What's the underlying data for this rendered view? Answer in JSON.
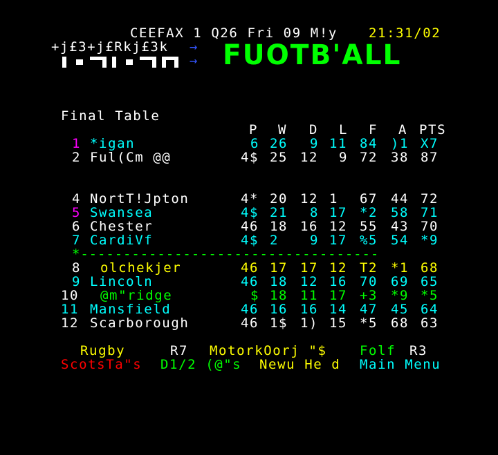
{
  "header": {
    "service": "CEEFAX 1 Q26 Fri 09 M!y",
    "clock": "21:31/02"
  },
  "mosaic_garble": "+j£3+j£Rkj£3k",
  "arrow1": "→",
  "arrow2": "→",
  "logo_text": "FUOTB'ALL",
  "table_title": "Final Table",
  "columns": [
    "P",
    "W",
    "D",
    "L",
    "F",
    "A",
    "PTS"
  ],
  "rows": [
    {
      "pos": "1",
      "team": "*igan",
      "p": "6",
      "w": "26",
      "d": "9",
      "l": "11",
      "f": "84",
      "a": ")1",
      "pts": "X7"
    },
    {
      "pos": "2",
      "team": "Ful(Cm @@",
      "p": "4$",
      "w": "25",
      "d": "12",
      "l": "9",
      "f": "72",
      "a": "38",
      "pts": "87"
    },
    {
      "pos": "4",
      "team": "NortT!Jpton",
      "p": "4*",
      "w": "20",
      "d": "12",
      "l": "1",
      "f": "67",
      "a": "44",
      "pts": "72"
    },
    {
      "pos": "5",
      "team": "Swansea",
      "p": "4$",
      "w": "21",
      "d": "8",
      "l": "17",
      "f": "*2",
      "a": "58",
      "pts": "71"
    },
    {
      "pos": "6",
      "team": "Chester",
      "p": "46",
      "w": "18",
      "d": "16",
      "l": "12",
      "f": "55",
      "a": "43",
      "pts": "70"
    },
    {
      "pos": "7",
      "team": "CardiVf",
      "p": "4$",
      "w": "2",
      "d": "9",
      "l": "17",
      "f": "%5",
      "a": "54",
      "pts": "*9"
    },
    {
      "pos": "8",
      "team": "olchekjer",
      "p": "46",
      "w": "17",
      "d": "17",
      "l": "12",
      "f": "T2",
      "a": "*1",
      "pts": "68"
    },
    {
      "pos": "9",
      "team": "Lincoln",
      "p": "46",
      "w": "18",
      "d": "12",
      "l": "16",
      "f": "70",
      "a": "69",
      "pts": "65"
    },
    {
      "pos": "10",
      "team": "@m\"ridge",
      "p": "$",
      "w": "18",
      "d": "11",
      "l": "17",
      "f": "+3",
      "a": "*9",
      "pts": "*5"
    },
    {
      "pos": "11",
      "team": "Mansfield",
      "p": "46",
      "w": "16",
      "d": "16",
      "l": "14",
      "f": "47",
      "a": "45",
      "pts": "64"
    },
    {
      "pos": "12",
      "team": "Scarborough",
      "p": "46",
      "w": "1$",
      "d": "1)",
      "l": "15",
      "f": "*5",
      "a": "68",
      "pts": "63"
    }
  ],
  "divider": "*-----------------------------------",
  "fastext1": {
    "rugby": "Rugby",
    "r7": "R7",
    "motor": "MotorkOorj \"$",
    "golf": "Folf",
    "r3": "R3"
  },
  "fastext2": {
    "red": "ScotsTa\"s",
    "green": "D1/2 (@\"s",
    "yellow": "Newu He d",
    "cyan": "Main Menu"
  },
  "colors": {
    "white": "#ffffff",
    "yellow": "#ffff00",
    "cyan": "#00ffff",
    "green": "#00ff00",
    "magenta": "#ff00ff",
    "red": "#ff0000",
    "blue": "#3355ff"
  }
}
